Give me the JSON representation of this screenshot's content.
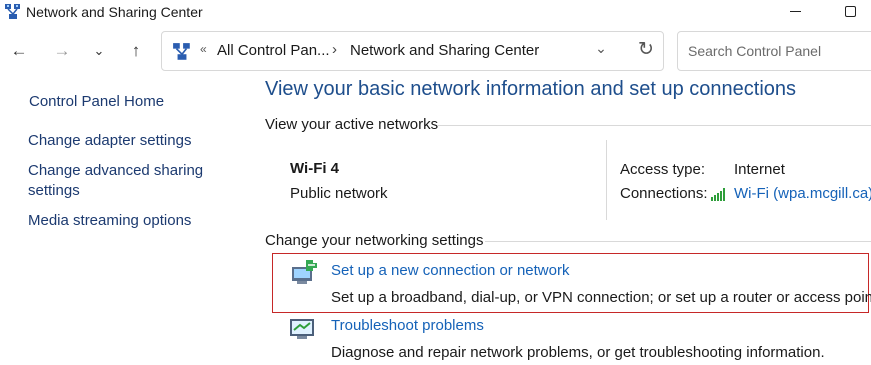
{
  "window": {
    "title": "Network and Sharing Center",
    "icon": "network-center-icon"
  },
  "nav": {
    "back_icon": "←",
    "forward_icon": "→",
    "recent_icon": "⌄",
    "up_icon": "↑",
    "address": {
      "overflow": "«",
      "crumb1": "All Control Pan...",
      "separator": "›",
      "crumb2": "Network and Sharing Center",
      "dropdown_icon": "⌄",
      "refresh_icon": "↻"
    },
    "search_placeholder": "Search Control Panel"
  },
  "sidebar": {
    "home": "Control Panel Home",
    "items": [
      {
        "label": "Change adapter settings"
      },
      {
        "label": "Change advanced sharing\nsettings"
      },
      {
        "label": "Media streaming options"
      }
    ]
  },
  "main": {
    "heading": "View your basic network information and set up connections",
    "active_networks_label": "View your active networks",
    "network": {
      "name": "Wi-Fi 4",
      "category": "Public network",
      "access_type_label": "Access type:",
      "access_type_value": "Internet",
      "connections_label": "Connections:",
      "connection_link": "Wi-Fi (wpa.mcgill.ca)"
    },
    "change_label": "Change your networking settings",
    "tasks": [
      {
        "link": "Set up a new connection or network",
        "description": "Set up a broadband, dial-up, or VPN connection; or set up a router or access point."
      },
      {
        "link": "Troubleshoot problems",
        "description": "Diagnose and repair network problems, or get troubleshooting information."
      }
    ]
  },
  "colors": {
    "heading": "#1e4e8c",
    "link": "#1562b8",
    "highlight_border": "#c62828"
  }
}
